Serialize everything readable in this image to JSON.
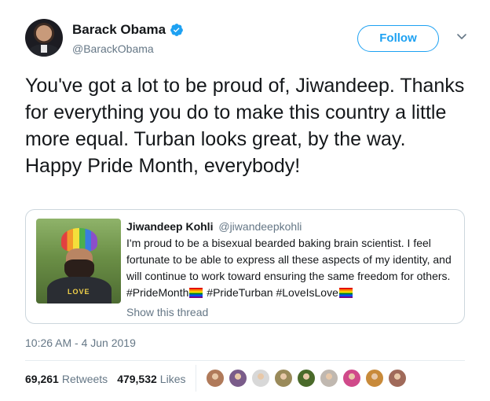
{
  "author": {
    "name": "Barack Obama",
    "handle": "@BarackObama",
    "verified": true,
    "avatar_icon": "user-avatar"
  },
  "actions": {
    "follow_label": "Follow",
    "menu_icon": "chevron-down-icon"
  },
  "tweet": {
    "text": "You've got a lot to be proud of, Jiwandeep. Thanks for everything you do to make this country a little more equal. Turban looks great, by the way. Happy Pride Month, everybody!"
  },
  "quoted_tweet": {
    "name": "Jiwandeep Kohli",
    "handle": "@jiwandeepkohli",
    "text_part1": "I'm proud to be a bisexual bearded baking brain scientist. I feel fortunate to be able to express all these aspects of my identity, and will continue to work toward ensuring the same freedom for others. #PrideMonth",
    "text_part2": " #PrideTurban #LoveIsLove",
    "emoji": "rainbow-flag",
    "shirt_text": "LOVE",
    "show_thread": "Show this thread"
  },
  "meta": {
    "timestamp": "10:26 AM - 4 Jun 2019"
  },
  "stats": {
    "retweets_count": "69,261",
    "retweets_label": "Retweets",
    "likes_count": "479,532",
    "likes_label": "Likes"
  },
  "likers": [
    {
      "color": "#b07a5a"
    },
    {
      "color": "#7a5c8a"
    },
    {
      "color": "#d8d8d8"
    },
    {
      "color": "#9a8a5a"
    },
    {
      "color": "#4a6a2a"
    },
    {
      "color": "#c0b8b0"
    },
    {
      "color": "#d04a8a"
    },
    {
      "color": "#c88a3a"
    },
    {
      "color": "#a06a5a"
    }
  ],
  "colors": {
    "accent": "#1da1f2",
    "text_primary": "#14171a",
    "text_secondary": "#657786",
    "border": "#ccd6dd"
  }
}
